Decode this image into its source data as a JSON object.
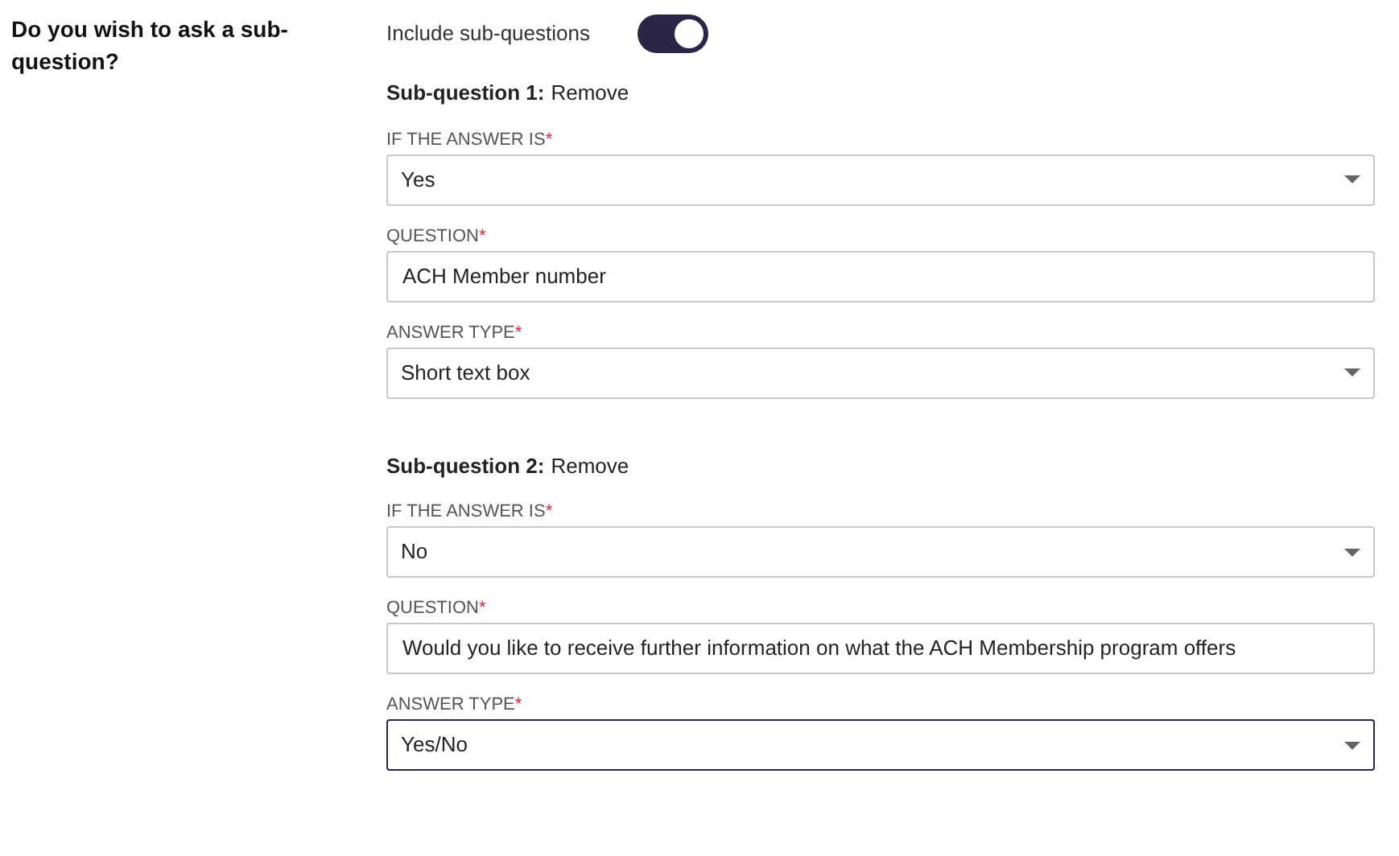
{
  "question_label": "Do you wish to ask a sub-question?",
  "toggle": {
    "label": "Include sub-questions",
    "on": true
  },
  "sub_questions": [
    {
      "title": "Sub-question 1:",
      "remove": "Remove",
      "fields": [
        {
          "kind": "select",
          "label": "IF THE ANSWER IS",
          "required_mark": "*",
          "value": "Yes",
          "focused": false
        },
        {
          "kind": "text",
          "label": "QUESTION",
          "required_mark": "*",
          "value": "ACH Member number",
          "focused": false
        },
        {
          "kind": "select",
          "label": "ANSWER TYPE",
          "required_mark": "*",
          "value": "Short text box",
          "focused": false
        }
      ]
    },
    {
      "title": "Sub-question 2:",
      "remove": "Remove",
      "fields": [
        {
          "kind": "select",
          "label": "IF THE ANSWER IS",
          "required_mark": "*",
          "value": "No",
          "focused": false
        },
        {
          "kind": "text",
          "label": "QUESTION",
          "required_mark": "*",
          "value": "Would you like to receive further information on what the ACH Membership program offers",
          "focused": false
        },
        {
          "kind": "select",
          "label": "ANSWER TYPE",
          "required_mark": "*",
          "value": "Yes/No",
          "focused": true
        }
      ]
    }
  ]
}
